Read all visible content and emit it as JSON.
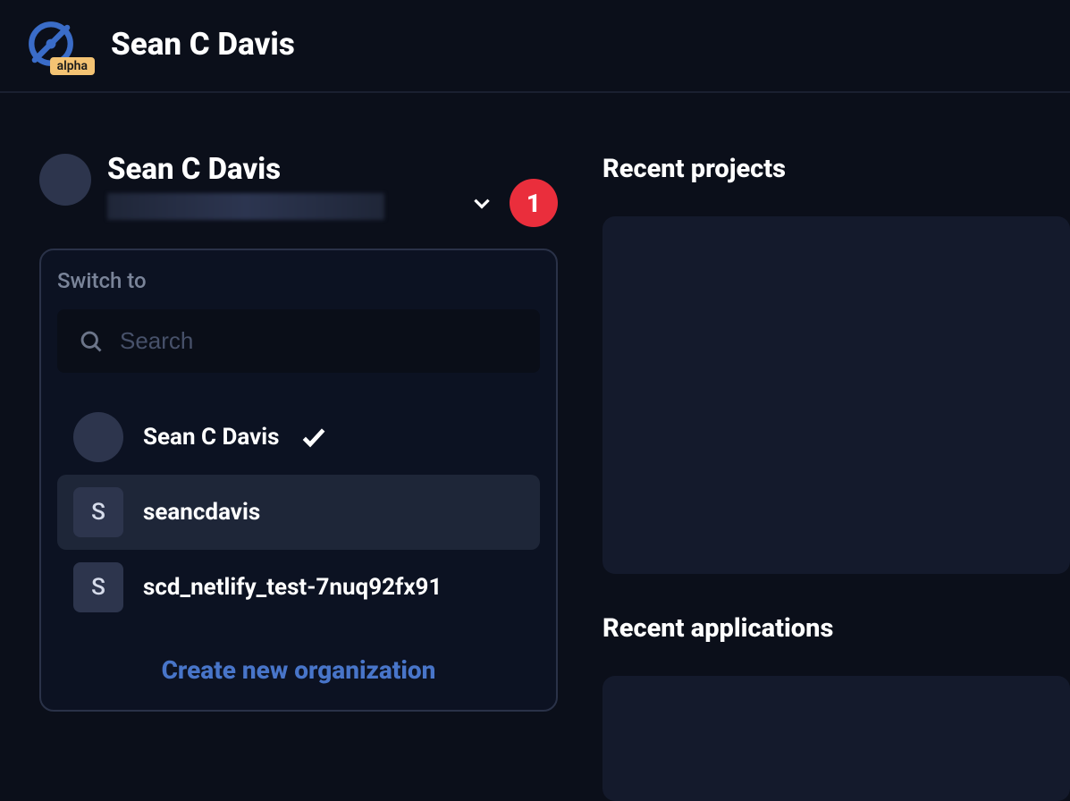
{
  "header": {
    "alpha_badge": "alpha",
    "title": "Sean C Davis"
  },
  "org_switcher": {
    "current_name": "Sean C Davis",
    "badge_count": "1",
    "dropdown_title": "Switch to",
    "search_placeholder": "Search",
    "items": [
      {
        "label": "Sean C Davis",
        "initial": "",
        "selected": true,
        "hovered": false,
        "avatar_shape": "circle"
      },
      {
        "label": "seancdavis",
        "initial": "S",
        "selected": false,
        "hovered": true,
        "avatar_shape": "square"
      },
      {
        "label": "scd_netlify_test-7nuq92fx91",
        "initial": "S",
        "selected": false,
        "hovered": false,
        "avatar_shape": "square"
      }
    ],
    "create_label": "Create new organization"
  },
  "sections": {
    "recent_projects": "Recent projects",
    "recent_applications": "Recent applications"
  }
}
